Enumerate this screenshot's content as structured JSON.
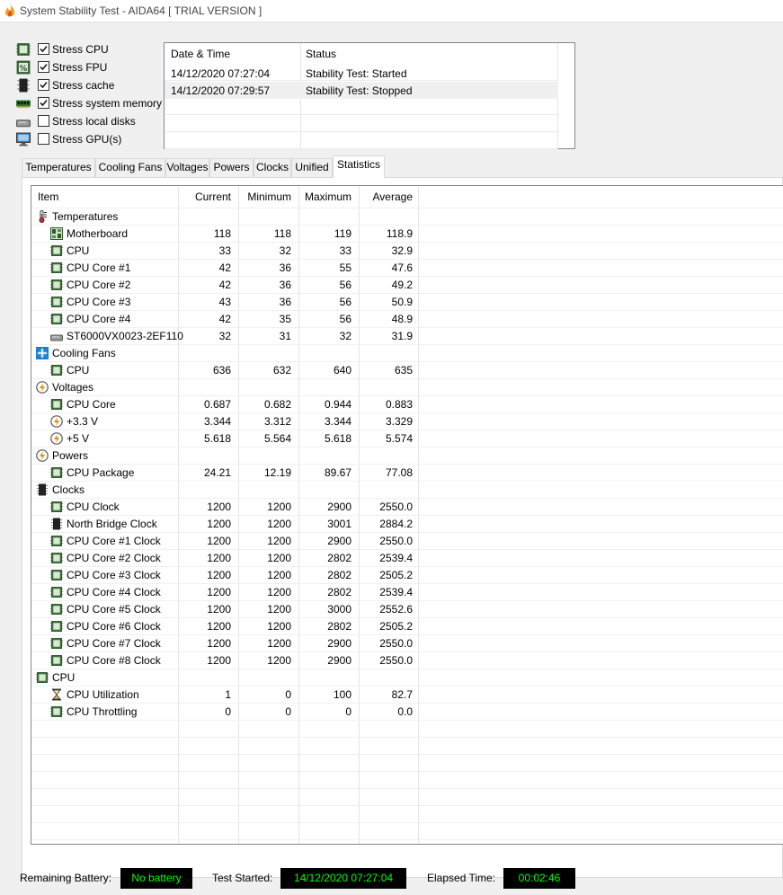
{
  "window": {
    "title": "System Stability Test - AIDA64  [ TRIAL VERSION ]"
  },
  "stress_options": [
    {
      "label": "Stress CPU",
      "checked": true,
      "icon": "cpu-chip-icon"
    },
    {
      "label": "Stress FPU",
      "checked": true,
      "icon": "fpu-icon"
    },
    {
      "label": "Stress cache",
      "checked": true,
      "icon": "cache-chip-icon"
    },
    {
      "label": "Stress system memory",
      "checked": true,
      "icon": "memory-module-icon"
    },
    {
      "label": "Stress local disks",
      "checked": false,
      "icon": "disk-drive-icon"
    },
    {
      "label": "Stress GPU(s)",
      "checked": false,
      "icon": "monitor-icon"
    }
  ],
  "log": {
    "headers": {
      "datetime": "Date & Time",
      "status": "Status"
    },
    "rows": [
      {
        "datetime": "14/12/2020 07:27:04",
        "status": "Stability Test: Started"
      },
      {
        "datetime": "14/12/2020 07:29:57",
        "status": "Stability Test: Stopped"
      }
    ]
  },
  "tabs": [
    "Temperatures",
    "Cooling Fans",
    "Voltages",
    "Powers",
    "Clocks",
    "Unified",
    "Statistics"
  ],
  "active_tab": "Statistics",
  "stats": {
    "headers": {
      "item": "Item",
      "current": "Current",
      "minimum": "Minimum",
      "maximum": "Maximum",
      "average": "Average"
    },
    "rows": [
      {
        "group": true,
        "name": "Temperatures",
        "icon": "thermometer-icon"
      },
      {
        "name": "Motherboard",
        "icon": "motherboard-icon",
        "cur": "118",
        "min": "118",
        "max": "119",
        "avg": "118.9"
      },
      {
        "name": "CPU",
        "icon": "cpu-chip-icon",
        "cur": "33",
        "min": "32",
        "max": "33",
        "avg": "32.9"
      },
      {
        "name": "CPU Core #1",
        "icon": "cpu-chip-icon",
        "cur": "42",
        "min": "36",
        "max": "55",
        "avg": "47.6"
      },
      {
        "name": "CPU Core #2",
        "icon": "cpu-chip-icon",
        "cur": "42",
        "min": "36",
        "max": "56",
        "avg": "49.2"
      },
      {
        "name": "CPU Core #3",
        "icon": "cpu-chip-icon",
        "cur": "43",
        "min": "36",
        "max": "56",
        "avg": "50.9"
      },
      {
        "name": "CPU Core #4",
        "icon": "cpu-chip-icon",
        "cur": "42",
        "min": "35",
        "max": "56",
        "avg": "48.9"
      },
      {
        "name": "ST6000VX0023-2EF110",
        "icon": "disk-drive-icon",
        "cur": "32",
        "min": "31",
        "max": "32",
        "avg": "31.9"
      },
      {
        "group": true,
        "name": "Cooling Fans",
        "icon": "fan-icon"
      },
      {
        "name": "CPU",
        "icon": "cpu-chip-icon",
        "cur": "636",
        "min": "632",
        "max": "640",
        "avg": "635"
      },
      {
        "group": true,
        "name": "Voltages",
        "icon": "voltage-icon"
      },
      {
        "name": "CPU Core",
        "icon": "cpu-chip-icon",
        "cur": "0.687",
        "min": "0.682",
        "max": "0.944",
        "avg": "0.883"
      },
      {
        "name": "+3.3 V",
        "icon": "voltage-icon",
        "cur": "3.344",
        "min": "3.312",
        "max": "3.344",
        "avg": "3.329"
      },
      {
        "name": "+5 V",
        "icon": "voltage-icon",
        "cur": "5.618",
        "min": "5.564",
        "max": "5.618",
        "avg": "5.574"
      },
      {
        "group": true,
        "name": "Powers",
        "icon": "power-icon"
      },
      {
        "name": "CPU Package",
        "icon": "cpu-chip-icon",
        "cur": "24.21",
        "min": "12.19",
        "max": "89.67",
        "avg": "77.08"
      },
      {
        "group": true,
        "name": "Clocks",
        "icon": "clock-chip-icon"
      },
      {
        "name": "CPU Clock",
        "icon": "cpu-chip-icon",
        "cur": "1200",
        "min": "1200",
        "max": "2900",
        "avg": "2550.0"
      },
      {
        "name": "North Bridge Clock",
        "icon": "clock-chip-icon",
        "cur": "1200",
        "min": "1200",
        "max": "3001",
        "avg": "2884.2"
      },
      {
        "name": "CPU Core #1 Clock",
        "icon": "cpu-chip-icon",
        "cur": "1200",
        "min": "1200",
        "max": "2900",
        "avg": "2550.0"
      },
      {
        "name": "CPU Core #2 Clock",
        "icon": "cpu-chip-icon",
        "cur": "1200",
        "min": "1200",
        "max": "2802",
        "avg": "2539.4"
      },
      {
        "name": "CPU Core #3 Clock",
        "icon": "cpu-chip-icon",
        "cur": "1200",
        "min": "1200",
        "max": "2802",
        "avg": "2505.2"
      },
      {
        "name": "CPU Core #4 Clock",
        "icon": "cpu-chip-icon",
        "cur": "1200",
        "min": "1200",
        "max": "2802",
        "avg": "2539.4"
      },
      {
        "name": "CPU Core #5 Clock",
        "icon": "cpu-chip-icon",
        "cur": "1200",
        "min": "1200",
        "max": "3000",
        "avg": "2552.6"
      },
      {
        "name": "CPU Core #6 Clock",
        "icon": "cpu-chip-icon",
        "cur": "1200",
        "min": "1200",
        "max": "2802",
        "avg": "2505.2"
      },
      {
        "name": "CPU Core #7 Clock",
        "icon": "cpu-chip-icon",
        "cur": "1200",
        "min": "1200",
        "max": "2900",
        "avg": "2550.0"
      },
      {
        "name": "CPU Core #8 Clock",
        "icon": "cpu-chip-icon",
        "cur": "1200",
        "min": "1200",
        "max": "2900",
        "avg": "2550.0"
      },
      {
        "group": true,
        "name": "CPU",
        "icon": "cpu-chip-icon"
      },
      {
        "name": "CPU Utilization",
        "icon": "hourglass-icon",
        "cur": "1",
        "min": "0",
        "max": "100",
        "avg": "82.7"
      },
      {
        "name": "CPU Throttling",
        "icon": "cpu-chip-icon",
        "cur": "0",
        "min": "0",
        "max": "0",
        "avg": "0.0"
      }
    ]
  },
  "footer": {
    "battery_label": "Remaining Battery:",
    "battery_value": "No battery",
    "started_label": "Test Started:",
    "started_value": "14/12/2020 07:27:04",
    "elapsed_label": "Elapsed Time:",
    "elapsed_value": "00:02:46"
  },
  "colors": {
    "footer_bg": "#000000",
    "footer_text": "#00ff00",
    "selected_row": "#f0f0f0",
    "border": "#828790"
  }
}
